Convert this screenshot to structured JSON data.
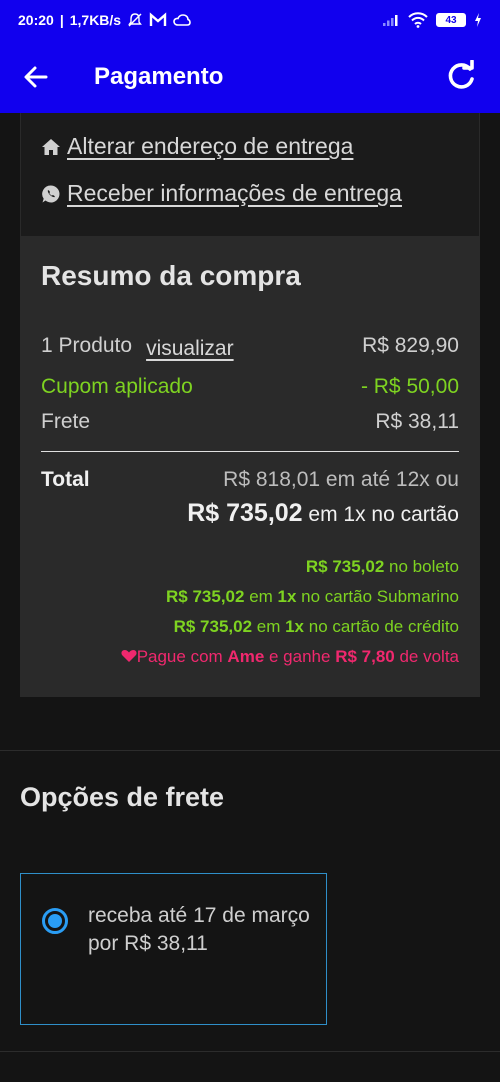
{
  "status": {
    "time": "20:20",
    "speed": "1,7KB/s",
    "battery": "43"
  },
  "appbar": {
    "title": "Pagamento"
  },
  "links": {
    "change_address": "Alterar endereço de entrega",
    "delivery_info": "Receber informações de entrega"
  },
  "summary": {
    "title": "Resumo da compra",
    "products_label": "1 Produto",
    "view_link": "visualizar",
    "products_value": "R$ 829,90",
    "coupon_label": "Cupom aplicado",
    "coupon_value": "- R$ 50,00",
    "shipping_label": "Frete",
    "shipping_value": "R$ 38,11",
    "total_label": "Total",
    "total_installments": "R$ 818,01 em até 12x ou",
    "total_card_amount": "R$ 735,02",
    "total_card_suffix": " em 1x no cartão",
    "boleto_amount": "R$ 735,02",
    "boleto_suffix": " no boleto",
    "submarino_amount": "R$ 735,02",
    "submarino_mid": " em ",
    "submarino_x": "1x",
    "submarino_suffix": " no cartão Submarino",
    "credit_amount": "R$ 735,02",
    "credit_mid": " em ",
    "credit_x": "1x",
    "credit_suffix": " no cartão de crédito",
    "ame_prefix": "Pague com ",
    "ame_brand": "Ame",
    "ame_mid": " e ganhe ",
    "ame_amount": "R$ 7,80",
    "ame_suffix": " de volta"
  },
  "shipping": {
    "title": "Opções de frete",
    "option_text": "receba até 17 de março por R$ 38,11"
  },
  "colors": {
    "brand_blue": "#1100ee",
    "green": "#7ed321",
    "pink": "#f0286e",
    "radio_blue": "#2a9df4"
  }
}
